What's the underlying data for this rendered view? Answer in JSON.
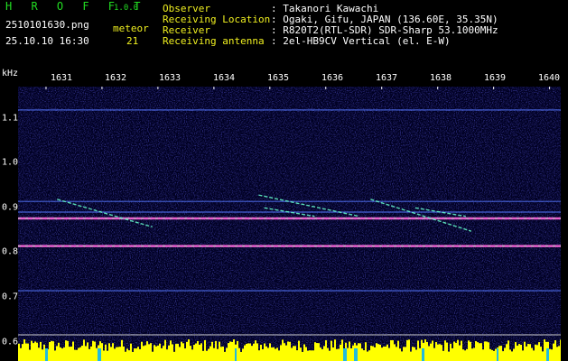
{
  "header": {
    "app_name": "H R O F F T",
    "version": "1.0.0",
    "filename": "2510101630.png",
    "datetime": "25.10.10 16:30",
    "meteor_label": "meteor",
    "meteor_count": "21"
  },
  "info": [
    {
      "key": "Observer",
      "value": ": Takanori Kawachi"
    },
    {
      "key": "Receiving Location",
      "value": ": Ogaki, Gifu, JAPAN (136.60E, 35.35N)"
    },
    {
      "key": "Receiver",
      "value": ": R820T2(RTL-SDR) SDR-Sharp 53.1000MHz"
    },
    {
      "key": "Receiving antenna",
      "value": ": 2el-HB9CV Vertical (el. E-W)"
    }
  ],
  "chart_data": {
    "type": "heatmap",
    "ylabel": "kHz",
    "x_ticks": [
      "1631",
      "1632",
      "1633",
      "1634",
      "1635",
      "1636",
      "1637",
      "1638",
      "1639",
      "1640"
    ],
    "y_ticks": [
      "1.1",
      "1.0",
      "0.9",
      "0.8",
      "0.7",
      "0.6"
    ],
    "y_range": [
      0.595,
      1.2
    ],
    "x_range": [
      1630.5,
      1640.2
    ],
    "carrier_lines_khz": [
      1.145,
      0.93,
      0.905,
      0.89,
      0.825,
      0.72
    ],
    "meteor_traces": [
      {
        "x0": 1631.2,
        "y0": 0.935,
        "x1": 1632.9,
        "y1": 0.87
      },
      {
        "x0": 1634.8,
        "y0": 0.945,
        "x1": 1636.6,
        "y1": 0.895
      },
      {
        "x0": 1636.8,
        "y0": 0.935,
        "x1": 1638.6,
        "y1": 0.86
      },
      {
        "x0": 1634.9,
        "y0": 0.915,
        "x1": 1635.8,
        "y1": 0.895
      },
      {
        "x0": 1637.6,
        "y0": 0.915,
        "x1": 1638.5,
        "y1": 0.895
      }
    ],
    "colors": {
      "background": "#000033",
      "carrier": "#5577ff",
      "trace": "#66ffcc",
      "power": "#ffff00"
    }
  }
}
